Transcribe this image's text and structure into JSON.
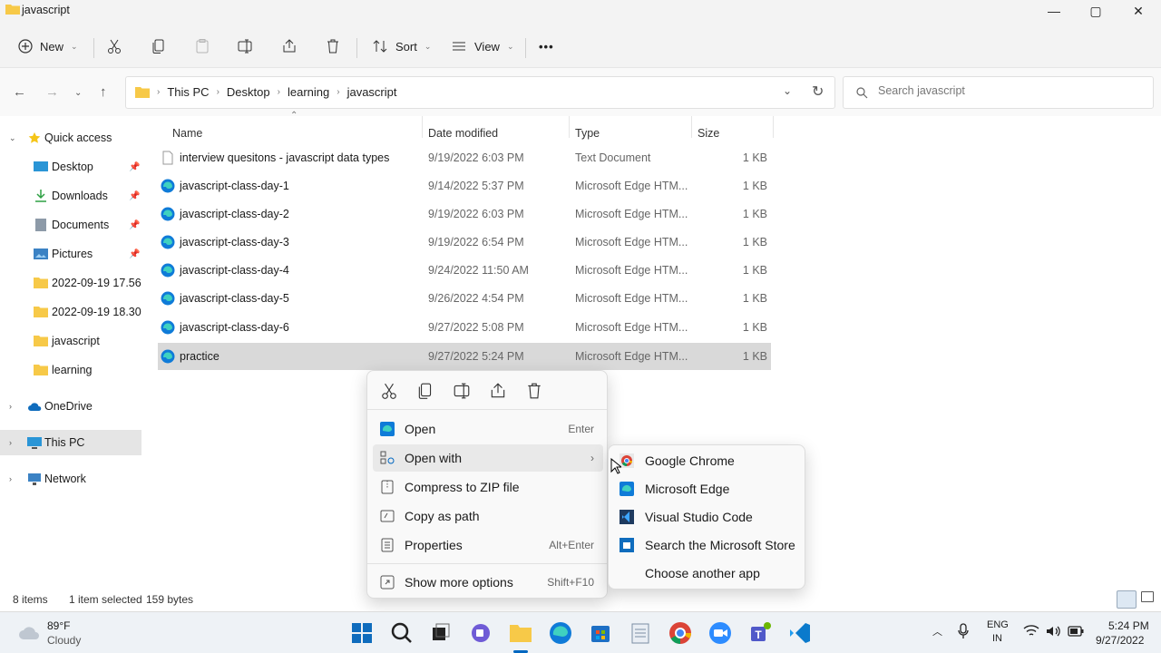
{
  "window": {
    "title": "javascript",
    "controls": {
      "minimize": "—",
      "maximize": "▢",
      "close": "✕"
    }
  },
  "toolbar": {
    "new_label": "New",
    "sort_label": "Sort",
    "view_label": "View",
    "more_label": "•••"
  },
  "address": {
    "crumbs": [
      "This PC",
      "Desktop",
      "learning",
      "javascript"
    ],
    "search_placeholder": "Search javascript"
  },
  "sidebar": {
    "items": [
      {
        "label": "Quick access",
        "icon": "star-icon"
      },
      {
        "label": "Desktop",
        "icon": "desktop-icon"
      },
      {
        "label": "Downloads",
        "icon": "download-icon"
      },
      {
        "label": "Documents",
        "icon": "document-icon"
      },
      {
        "label": "Pictures",
        "icon": "pictures-icon"
      },
      {
        "label": "2022-09-19 17.56.",
        "icon": "folder-icon"
      },
      {
        "label": "2022-09-19 18.30.",
        "icon": "folder-icon"
      },
      {
        "label": "javascript",
        "icon": "folder-icon"
      },
      {
        "label": "learning",
        "icon": "folder-icon"
      },
      {
        "label": "OneDrive",
        "icon": "cloud-icon"
      },
      {
        "label": "This PC",
        "icon": "pc-icon"
      },
      {
        "label": "Network",
        "icon": "network-icon"
      }
    ]
  },
  "columns": {
    "name": "Name",
    "date": "Date modified",
    "type": "Type",
    "size": "Size"
  },
  "files": [
    {
      "name": "interview quesitons - javascript data types",
      "date": "9/19/2022 6:03 PM",
      "type": "Text Document",
      "size": "1 KB"
    },
    {
      "name": "javascript-class-day-1",
      "date": "9/14/2022 5:37 PM",
      "type": "Microsoft Edge HTM...",
      "size": "1 KB"
    },
    {
      "name": "javascript-class-day-2",
      "date": "9/19/2022 6:03 PM",
      "type": "Microsoft Edge HTM...",
      "size": "1 KB"
    },
    {
      "name": "javascript-class-day-3",
      "date": "9/19/2022 6:54 PM",
      "type": "Microsoft Edge HTM...",
      "size": "1 KB"
    },
    {
      "name": "javascript-class-day-4",
      "date": "9/24/2022 11:50 AM",
      "type": "Microsoft Edge HTM...",
      "size": "1 KB"
    },
    {
      "name": "javascript-class-day-5",
      "date": "9/26/2022 4:54 PM",
      "type": "Microsoft Edge HTM...",
      "size": "1 KB"
    },
    {
      "name": "javascript-class-day-6",
      "date": "9/27/2022 5:08 PM",
      "type": "Microsoft Edge HTM...",
      "size": "1 KB"
    },
    {
      "name": "practice",
      "date": "9/27/2022 5:24 PM",
      "type": "Microsoft Edge HTM...",
      "size": "1 KB"
    }
  ],
  "status": {
    "items": "8 items",
    "selected": "1 item selected",
    "bytes": "159 bytes"
  },
  "context_menu": {
    "open": {
      "label": "Open",
      "shortcut": "Enter"
    },
    "open_with": {
      "label": "Open with",
      "arrow": "›"
    },
    "compress": {
      "label": "Compress to ZIP file"
    },
    "copy_path": {
      "label": "Copy as path"
    },
    "properties": {
      "label": "Properties",
      "shortcut": "Alt+Enter"
    },
    "more": {
      "label": "Show more options",
      "shortcut": "Shift+F10"
    }
  },
  "submenu": {
    "items": [
      "Google Chrome",
      "Microsoft Edge",
      "Visual Studio Code",
      "Search the Microsoft Store",
      "Choose another app"
    ]
  },
  "taskbar": {
    "temp": "89°F",
    "condition": "Cloudy",
    "lang1": "ENG",
    "lang2": "IN",
    "time": "5:24 PM",
    "date": "9/27/2022"
  },
  "colors": {
    "edge": "#0f7bd8",
    "folder": "#f7c948",
    "accent": "#0067c0"
  }
}
